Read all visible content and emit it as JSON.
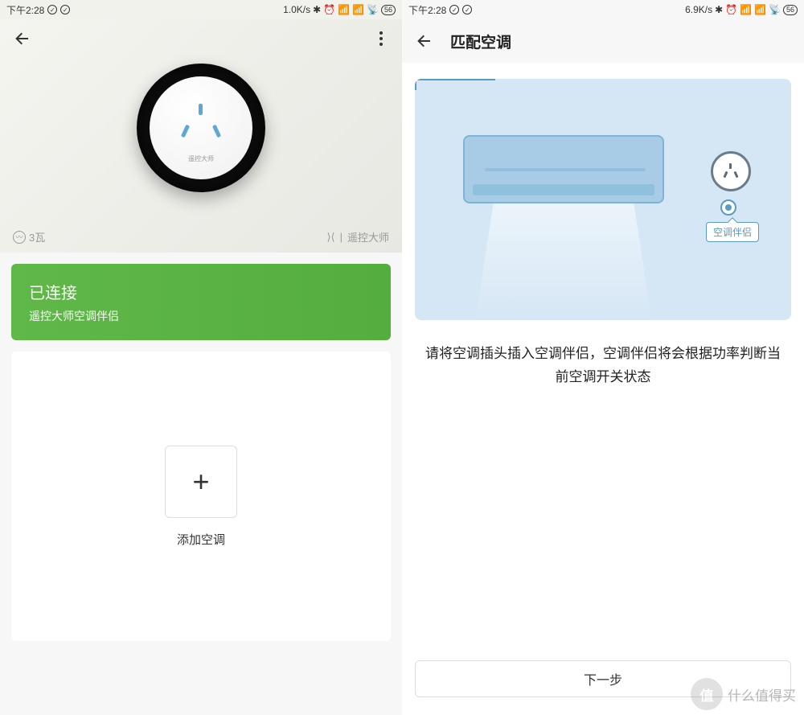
{
  "status": {
    "time": "下午2:28",
    "speed1": "1.0K/s",
    "speed2": "6.9K/s",
    "battery": "56"
  },
  "screen1": {
    "watts": "3瓦",
    "brand": "遥控大师",
    "device_brand_small": "遥控大师",
    "connected_title": "已连接",
    "connected_sub": "遥控大师空调伴侣",
    "add_label": "添加空调"
  },
  "screen2": {
    "title": "匹配空调",
    "tag": "空调伴侣",
    "instruction": "请将空调插头插入空调伴侣，空调伴侣将会根据功率判断当前空调开关状态",
    "next": "下一步"
  },
  "watermark": {
    "circle": "值",
    "text": "什么值得买"
  }
}
